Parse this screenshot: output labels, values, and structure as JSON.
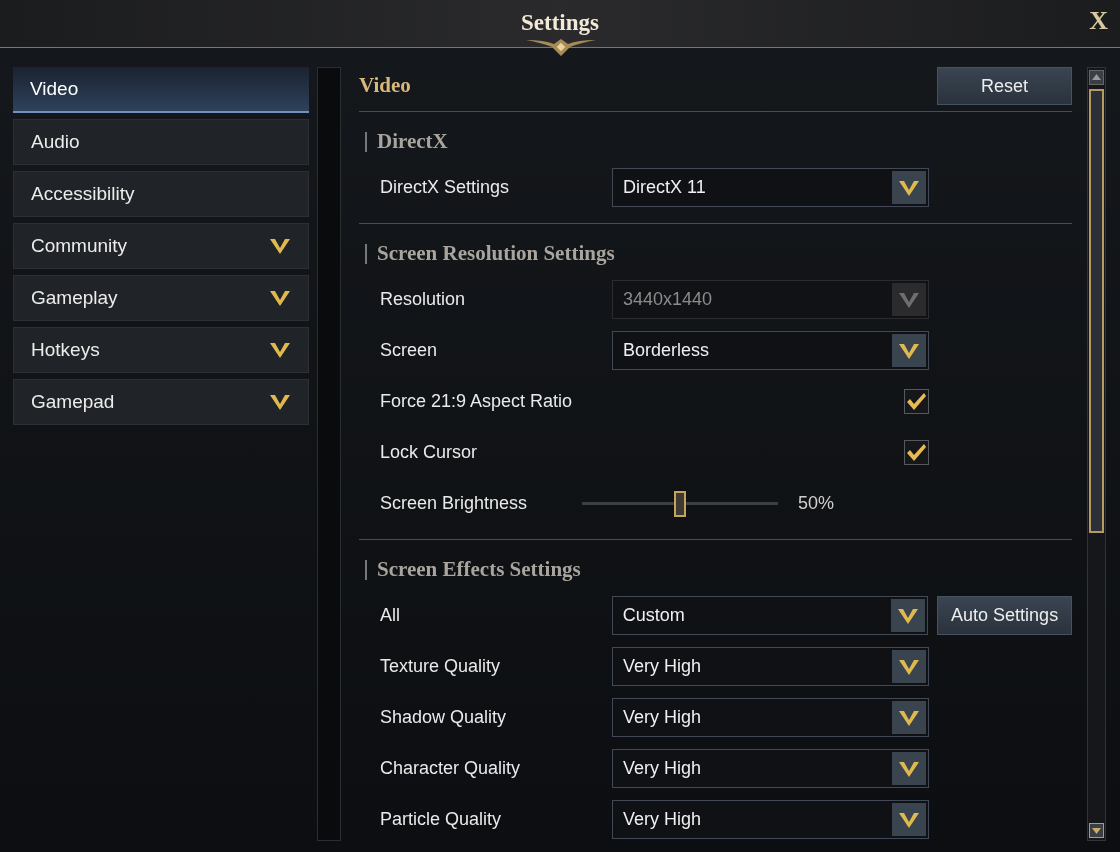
{
  "window": {
    "title": "Settings",
    "close": "X"
  },
  "sidebar": {
    "items": [
      {
        "label": "Video",
        "selected": true,
        "expandable": false
      },
      {
        "label": "Audio",
        "selected": false,
        "expandable": false
      },
      {
        "label": "Accessibility",
        "selected": false,
        "expandable": false
      },
      {
        "label": "Community",
        "selected": false,
        "expandable": true
      },
      {
        "label": "Gameplay",
        "selected": false,
        "expandable": true
      },
      {
        "label": "Hotkeys",
        "selected": false,
        "expandable": true
      },
      {
        "label": "Gamepad",
        "selected": false,
        "expandable": true
      }
    ]
  },
  "content": {
    "title": "Video",
    "reset_button": "Reset",
    "sections": [
      {
        "title": "DirectX",
        "rows": [
          {
            "kind": "dropdown",
            "label": "DirectX Settings",
            "value": "DirectX 11",
            "disabled": false
          }
        ]
      },
      {
        "title": "Screen Resolution Settings",
        "rows": [
          {
            "kind": "dropdown",
            "label": "Resolution",
            "value": "3440x1440",
            "disabled": true
          },
          {
            "kind": "dropdown",
            "label": "Screen",
            "value": "Borderless",
            "disabled": false
          },
          {
            "kind": "checkbox",
            "label": "Force 21:9 Aspect Ratio",
            "checked": true
          },
          {
            "kind": "checkbox",
            "label": "Lock Cursor",
            "checked": true
          },
          {
            "kind": "slider",
            "label": "Screen Brightness",
            "level": 0.5,
            "reading": "50%"
          }
        ]
      },
      {
        "title": "Screen Effects Settings",
        "rows": [
          {
            "kind": "dropdown",
            "label": "All",
            "value": "Custom",
            "disabled": false,
            "button": "Auto Settings"
          },
          {
            "kind": "dropdown",
            "label": "Texture Quality",
            "value": "Very High",
            "disabled": false
          },
          {
            "kind": "dropdown",
            "label": "Shadow Quality",
            "value": "Very High",
            "disabled": false
          },
          {
            "kind": "dropdown",
            "label": "Character Quality",
            "value": "Very High",
            "disabled": false
          },
          {
            "kind": "dropdown",
            "label": "Particle Quality",
            "value": "Very High",
            "disabled": false
          }
        ]
      }
    ]
  }
}
